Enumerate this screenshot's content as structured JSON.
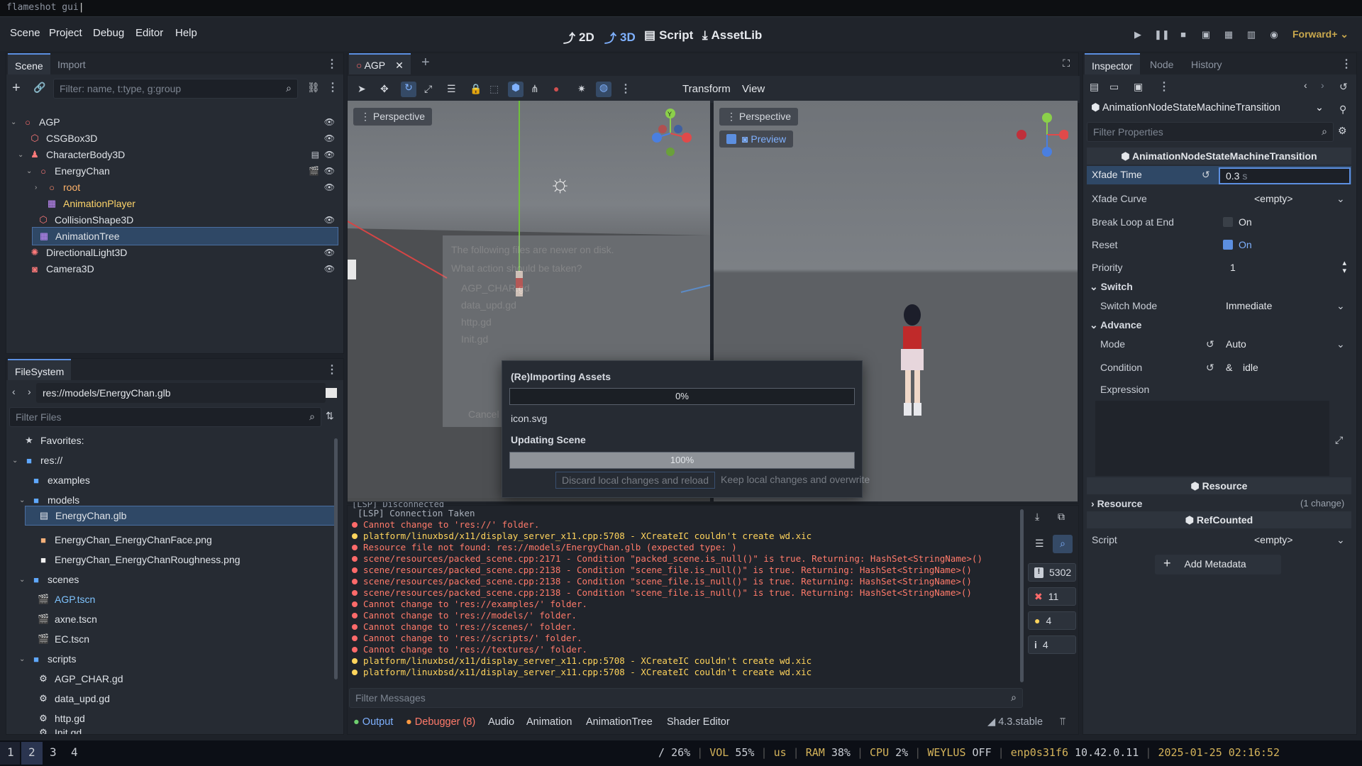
{
  "window_title": "flameshot gui",
  "menus": [
    "Scene",
    "Project",
    "Debug",
    "Editor",
    "Help"
  ],
  "modes": [
    "2D",
    "3D",
    "Script",
    "AssetLib"
  ],
  "renderer": "Forward+",
  "scene_dock": {
    "tabs": [
      "Scene",
      "Import"
    ],
    "filter_placeholder": "Filter: name, t:type, g:group",
    "nodes": [
      {
        "name": "AGP",
        "color": "#ff6b6b",
        "icon": "node3d-icon"
      },
      {
        "name": "CSGBox3D",
        "color": "#ff7a7a",
        "icon": "csg-box-icon"
      },
      {
        "name": "CharacterBody3D",
        "color": "#ff7a7a",
        "icon": "character-body-icon"
      },
      {
        "name": "EnergyChan",
        "color": "#ff7a7a",
        "icon": "node3d-icon"
      },
      {
        "name": "root",
        "color": "#ff8a6a",
        "icon": "node3d-icon"
      },
      {
        "name": "AnimationPlayer",
        "color": "#c58cff",
        "icon": "animation-player-icon"
      },
      {
        "name": "CollisionShape3D",
        "color": "#ff7a7a",
        "icon": "collision-shape-icon"
      },
      {
        "name": "AnimationTree",
        "color": "#c58cff",
        "icon": "animation-tree-icon"
      },
      {
        "name": "DirectionalLight3D",
        "color": "#ff7a7a",
        "icon": "light-icon"
      },
      {
        "name": "Camera3D",
        "color": "#ff7a7a",
        "icon": "camera-icon"
      }
    ]
  },
  "filesystem": {
    "tab": "FileSystem",
    "path": "res://models/EnergyChan.glb",
    "filter_placeholder": "Filter Files",
    "items": [
      "Favorites:",
      "res://",
      "examples",
      "models",
      "EnergyChan.glb",
      "EnergyChan_EnergyChanFace.png",
      "EnergyChan_EnergyChanRoughness.png",
      "scenes",
      "AGP.tscn",
      "axne.tscn",
      "EC.tscn",
      "scripts",
      "AGP_CHAR.gd",
      "data_upd.gd",
      "http.gd",
      "Init.gd"
    ]
  },
  "editor_tab": "AGP",
  "viewport_menu": [
    "Transform",
    "View"
  ],
  "viewport_left": {
    "label": "Perspective"
  },
  "viewport_right": {
    "label": "Perspective",
    "preview": "Preview"
  },
  "faded_dialog": {
    "line1": "The following files are newer on disk.",
    "line2": "What action should be taken?",
    "files": [
      "AGP_CHAR.gd",
      "data_upd.gd",
      "http.gd",
      "Init.gd"
    ],
    "cancel": "Cancel",
    "discard": "Discard local changes and reload",
    "keep": "Keep local changes and overwrite"
  },
  "import_dialog": {
    "title": "(Re)Importing Assets",
    "progress1_text": "0%",
    "progress1": 0,
    "file": "icon.svg",
    "title2": "Updating Scene",
    "progress2_text": "100%",
    "progress2": 1.0
  },
  "log": [
    {
      "t": "i",
      "m": "[LSP] Connection Taken"
    },
    {
      "t": "e",
      "m": "Cannot change to 'res://' folder."
    },
    {
      "t": "w",
      "m": "platform/linuxbsd/x11/display_server_x11.cpp:5708 - XCreateIC couldn't create wd.xic"
    },
    {
      "t": "e",
      "m": "Resource file not found: res://models/EnergyChan.glb (expected type: )"
    },
    {
      "t": "e",
      "m": "scene/resources/packed_scene.cpp:2171 - Condition \"packed_scene.is_null()\" is true. Returning: HashSet<StringName>()"
    },
    {
      "t": "e",
      "m": "scene/resources/packed_scene.cpp:2138 - Condition \"scene_file.is_null()\" is true. Returning: HashSet<StringName>()"
    },
    {
      "t": "e",
      "m": "scene/resources/packed_scene.cpp:2138 - Condition \"scene_file.is_null()\" is true. Returning: HashSet<StringName>()"
    },
    {
      "t": "e",
      "m": "scene/resources/packed_scene.cpp:2138 - Condition \"scene_file.is_null()\" is true. Returning: HashSet<StringName>()"
    },
    {
      "t": "e",
      "m": "Cannot change to 'res://examples/' folder."
    },
    {
      "t": "e",
      "m": "Cannot change to 'res://models/' folder."
    },
    {
      "t": "e",
      "m": "Cannot change to 'res://scenes/' folder."
    },
    {
      "t": "e",
      "m": "Cannot change to 'res://scripts/' folder."
    },
    {
      "t": "e",
      "m": "Cannot change to 'res://textures/' folder."
    },
    {
      "t": "w",
      "m": "platform/linuxbsd/x11/display_server_x11.cpp:5708 - XCreateIC couldn't create wd.xic"
    },
    {
      "t": "w",
      "m": "platform/linuxbsd/x11/display_server_x11.cpp:5708 - XCreateIC couldn't create wd.xic"
    }
  ],
  "log_top_cut": "[LSP] Disconnected",
  "counters": {
    "all": "5302",
    "errors": "11",
    "warnings": "4",
    "info": "4"
  },
  "filter_messages": "Filter Messages",
  "bottom_tabs": [
    "Output",
    "Debugger (8)",
    "Audio",
    "Animation",
    "AnimationTree",
    "Shader Editor"
  ],
  "version": "4.3.stable",
  "inspector": {
    "tabs": [
      "Inspector",
      "Node",
      "History"
    ],
    "resource": "AnimationNodeStateMachineTransition",
    "filter_placeholder": "Filter Properties",
    "class_header": "AnimationNodeStateMachineTransition",
    "xfade_time_label": "Xfade Time",
    "xfade_time": "0.3",
    "xfade_unit": "s",
    "xfade_curve_label": "Xfade Curve",
    "empty": "<empty>",
    "break_loop_label": "Break Loop at End",
    "on": "On",
    "reset_label": "Reset",
    "priority_label": "Priority",
    "priority": "1",
    "switch_section": "Switch",
    "switch_mode_label": "Switch Mode",
    "switch_mode": "Immediate",
    "advance_section": "Advance",
    "mode_label": "Mode",
    "mode": "Auto",
    "condition_label": "Condition",
    "condition_prefix": "&",
    "condition": "idle",
    "expression_label": "Expression",
    "resource_header": "Resource",
    "resource_section": "Resource",
    "resource_changes": "(1 change)",
    "refcounted_header": "RefCounted",
    "script_label": "Script",
    "add_metadata": "Add Metadata"
  },
  "taskbar": {
    "workspaces": [
      "1",
      "2",
      "3",
      "4"
    ],
    "status": [
      {
        "label": "/",
        "value": "26%"
      },
      {
        "label": "VOL",
        "value": "55%"
      },
      {
        "label": "",
        "value": "us"
      },
      {
        "label": "RAM",
        "value": "38%"
      },
      {
        "label": "CPU",
        "value": "2%"
      },
      {
        "label": "WEYLUS",
        "value": "OFF"
      },
      {
        "label": "enp0s31f6",
        "value": "10.42.0.11"
      },
      {
        "label": "",
        "value": "2025-01-25 02:16:52"
      }
    ]
  },
  "colors": {
    "accent": "#5c8fe0",
    "error": "#ff7a6a",
    "warning": "#ffd45c",
    "renderer": "#c9a84d",
    "selection": "#2f4866"
  }
}
